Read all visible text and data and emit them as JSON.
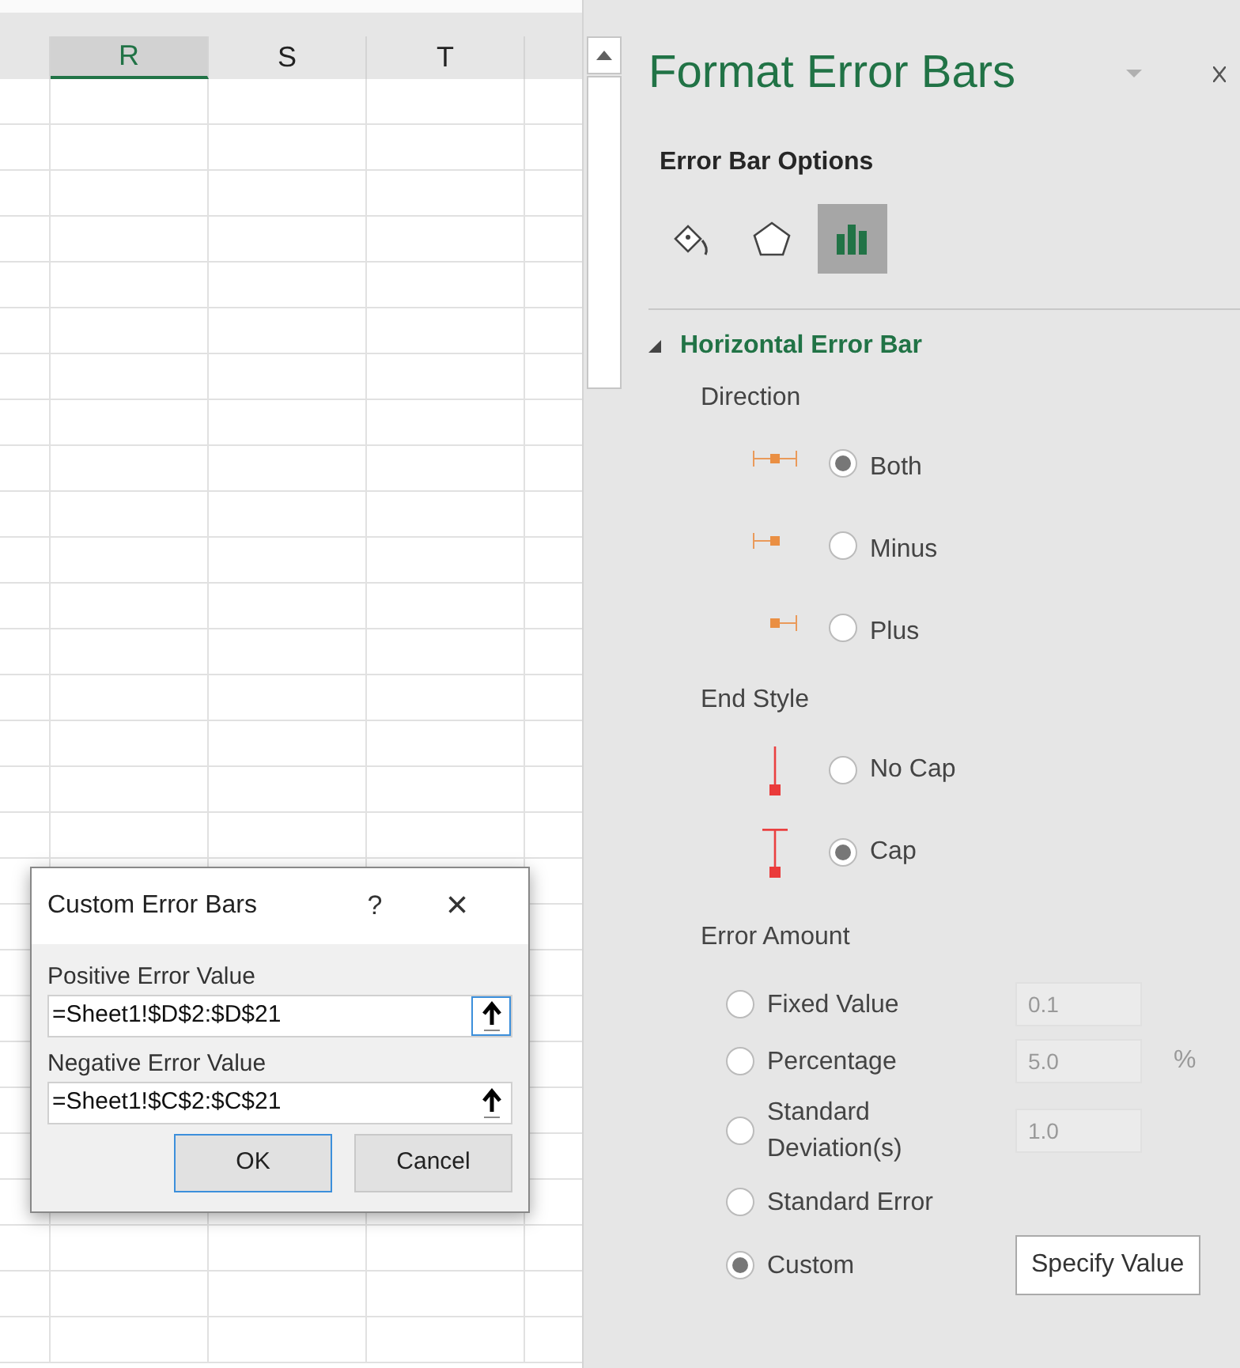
{
  "sheet": {
    "columns": [
      {
        "label": "R",
        "selected": true
      },
      {
        "label": "S",
        "selected": false
      },
      {
        "label": "T",
        "selected": false
      }
    ]
  },
  "pane": {
    "title": "Format Error Bars",
    "subtitle": "Error Bar Options",
    "tabs": [
      {
        "kind": "fill",
        "selected": false
      },
      {
        "kind": "effects",
        "selected": false
      },
      {
        "kind": "options",
        "selected": true
      }
    ],
    "section": {
      "title": "Horizontal Error Bar",
      "expanded": true
    },
    "direction": {
      "label": "Direction",
      "options": [
        {
          "kind": "both",
          "label": "Both",
          "selected": true
        },
        {
          "kind": "minus",
          "label": "Minus",
          "selected": false
        },
        {
          "kind": "plus",
          "label": "Plus",
          "selected": false
        }
      ]
    },
    "end_style": {
      "label": "End Style",
      "options": [
        {
          "kind": "nocap",
          "label": "No Cap",
          "selected": false
        },
        {
          "kind": "cap",
          "label": "Cap",
          "selected": true
        }
      ]
    },
    "error_amount": {
      "label": "Error Amount",
      "options": [
        {
          "kind": "field",
          "label": "Fixed Value",
          "value": "0.1",
          "disabled": true,
          "selected": false
        },
        {
          "kind": "field",
          "label": "Percentage",
          "value": "5.0",
          "unit": "%",
          "disabled": true,
          "selected": false
        },
        {
          "kind": "field",
          "label": "Standard Deviation(s)",
          "value": "1.0",
          "disabled": true,
          "selected": false
        },
        {
          "kind": "plain",
          "label": "Standard Error",
          "selected": false
        },
        {
          "kind": "button",
          "label": "Custom",
          "button": "Specify Value",
          "selected": true
        }
      ]
    }
  },
  "dialog": {
    "title": "Custom Error Bars",
    "help": "?",
    "close": "×",
    "fields": [
      {
        "label": "Positive Error Value",
        "value": "=Sheet1!$D$2:$D$21",
        "focused": true
      },
      {
        "label": "Negative Error Value",
        "value": "=Sheet1!$C$2:$C$21",
        "focused": false
      }
    ],
    "buttons": [
      {
        "label": "OK",
        "default": true
      },
      {
        "label": "Cancel",
        "default": false
      }
    ]
  }
}
